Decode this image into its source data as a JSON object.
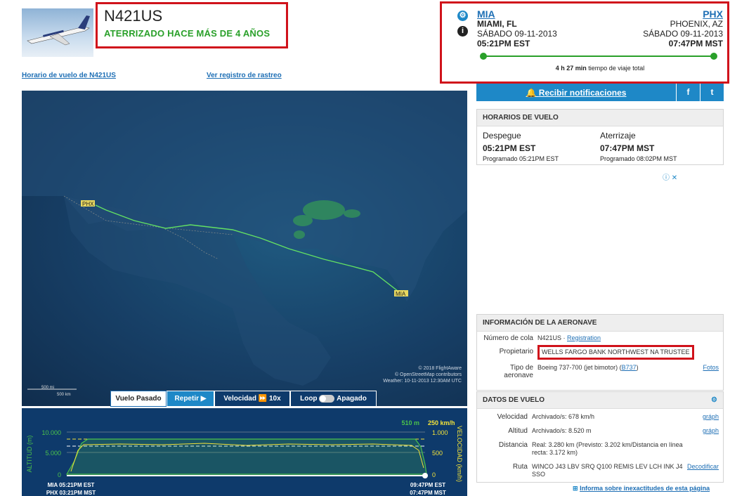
{
  "flight": {
    "tail": "N421US",
    "status": "ATERRIZADO HACE MÁS DE 4 AÑOS"
  },
  "route": {
    "origin_code": "MIA",
    "dest_code": "PHX",
    "origin_city": "MIAMI, FL",
    "dest_city": "PHOENIX, AZ",
    "origin_date": "SÁBADO 09-11-2013",
    "dest_date": "SÁBADO 09-11-2013",
    "origin_time": "05:21PM EST",
    "dest_time": "07:47PM MST",
    "duration_bold": "4 h 27 min",
    "duration_rest": "tiempo de viaje total"
  },
  "links": {
    "schedule": "Horario de vuelo de N421US",
    "track_log": "Ver registro de rastreo"
  },
  "notify": {
    "label": "Recibir notificaciones",
    "fb": "f",
    "tw": "t"
  },
  "schedule": {
    "title": "HORARIOS DE VUELO",
    "dep_label": "Despegue",
    "arr_label": "Aterrizaje",
    "dep_time": "05:21PM EST",
    "arr_time": "07:47PM MST",
    "dep_sched": "Programado 05:21PM EST",
    "arr_sched": "Programado 08:02PM MST"
  },
  "ad": {
    "choices": "ⓘ ✕"
  },
  "map": {
    "label_phx": "PHX",
    "label_mia": "MIA",
    "credit1": "© 2018 FlightAware",
    "credit2": "© OpenStreetMap contributors",
    "credit3": "Weather: 10-11-2013 12:30AM UTC",
    "scale1": "500 mi",
    "scale2": "500 km"
  },
  "controls": {
    "past": "Vuelo Pasado",
    "replay": "Repetir",
    "speed_label": "Velocidad",
    "speed_val": "10x",
    "loop_label": "Loop",
    "loop_val": "Apagado"
  },
  "altchart": {
    "ylabel_left": "ALTITUD (m)",
    "ylabel_right": "VELOCIDAD (km/h)",
    "y1": "10.000",
    "y2": "5.000",
    "y3": "0",
    "r1": "1.000",
    "r2": "500",
    "r3": "0",
    "top_alt": "510 m",
    "top_spd": "250 km/h",
    "dep1": "MIA 05:21PM EST",
    "dep2": "PHX 03:21PM MST",
    "arr1": "09:47PM EST",
    "arr2": "07:47PM MST"
  },
  "aircraft": {
    "title": "INFORMACIÓN DE LA AERONAVE",
    "tail_label": "Número de cola",
    "tail_val": "N421US ·",
    "registration": "Registration",
    "owner_label": "Propietario",
    "owner_val": "WELLS FARGO BANK NORTHWEST NA TRUSTEE",
    "type_label": "Tipo de aeronave",
    "type_val": "Boeing 737-700 (jet bimotor) (",
    "type_code": "B737",
    "type_close": ")",
    "photos": "Fotos"
  },
  "flightdata": {
    "title": "DATOS DE VUELO",
    "speed_label": "Velocidad",
    "speed_val": "Archivado/s: 678 km/h",
    "alt_label": "Altitud",
    "alt_val": "Archivado/s: 8.520 m",
    "graph": "gráph",
    "graph2": "gráph",
    "dist_label": "Distancia",
    "dist_val": "Real: 3.280 km (Previsto: 3.202 km/Distancia en línea recta: 3.172 km)",
    "route_label": "Ruta",
    "route_val": "WINCO J43 LBV SRQ Q100 REMIS LEV LCH INK J4 SSO",
    "decode": "Decodificar"
  },
  "report": {
    "label": "Informa sobre inexactitudes de esta página"
  }
}
